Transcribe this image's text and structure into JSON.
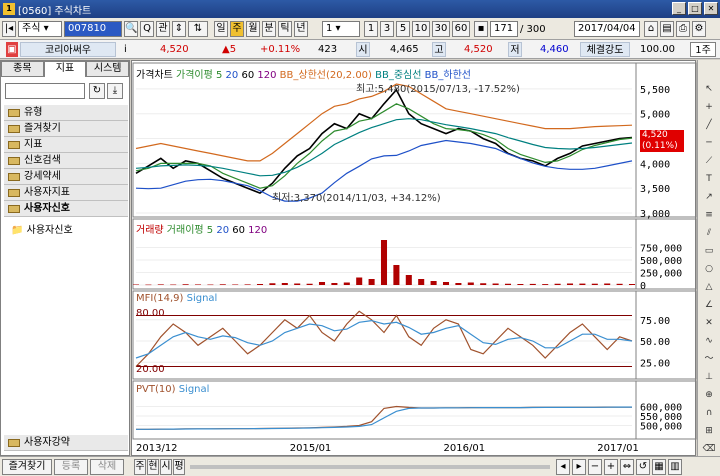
{
  "window": {
    "title": "[0560] 주식차트"
  },
  "toolbar": {
    "market": "주식",
    "code": "007810",
    "gwan": "관",
    "periods": [
      "일",
      "주",
      "월",
      "분",
      "틱",
      "년"
    ],
    "interval": "1",
    "steps": [
      "1",
      "3",
      "5",
      "10",
      "30",
      "60"
    ],
    "count": "171",
    "total": "/ 300",
    "date": "2017/04/04"
  },
  "stock": {
    "name": "코리아써우",
    "price": "4,520",
    "change": "▲5",
    "rate": "+0.11%",
    "volume": "423",
    "open_label": "시",
    "open": "4,465",
    "high_label": "고",
    "high": "4,520",
    "low_label": "저",
    "low": "4,460",
    "strength_label": "체결강도",
    "strength": "100.00",
    "unit": "1주"
  },
  "sidebar": {
    "tabs": [
      "종목",
      "지표",
      "시스템"
    ],
    "items": [
      "유형",
      "즐겨찾기",
      "지표",
      "신호검색",
      "강세약세",
      "사용자지표",
      "사용자신호"
    ],
    "subitem": "사용자신호",
    "bottom_item": "사용자강약",
    "bottom_buttons": [
      "즐겨찾기",
      "등록",
      "삭제"
    ]
  },
  "bottom": {
    "tabs": [
      "주",
      "현",
      "시",
      "평"
    ]
  },
  "chart_data": [
    {
      "type": "line",
      "title": "가격차트",
      "legend": [
        "가격차트",
        "가격이평 5",
        "20",
        "60",
        "120",
        "BB_상한선(20,2.00)",
        "BB_중심선",
        "BB_하한선"
      ],
      "y_ticks": [
        "5,500",
        "5,000",
        "4,500",
        "4,000",
        "3,500",
        "3,000"
      ],
      "ylim": [
        3000,
        5700
      ],
      "annotations": {
        "max": "최고:5,480(2015/07/13, -17.52%)",
        "min": "최저:3,370(2014/11/03, +34.12%)"
      },
      "price_label": "4,520",
      "price_rate": "(0.11%)",
      "x": [
        0,
        1,
        2,
        3,
        4,
        5,
        6,
        7,
        8,
        9,
        10,
        11,
        12,
        13,
        14,
        15,
        16,
        17,
        18,
        19,
        20,
        21,
        22,
        23,
        24,
        25,
        26,
        27,
        28,
        29,
        30,
        31,
        32,
        33,
        34,
        35,
        36,
        37,
        38,
        39,
        40
      ],
      "series": [
        {
          "name": "가격차트",
          "color": "#000000",
          "values": [
            3800,
            3950,
            4100,
            3900,
            4050,
            4000,
            3850,
            3700,
            3600,
            3500,
            3400,
            3600,
            3900,
            4150,
            4300,
            4600,
            4800,
            4700,
            5000,
            4900,
            5200,
            5480,
            5000,
            4800,
            4700,
            4600,
            4700,
            4650,
            4500,
            4400,
            4200,
            4100,
            4050,
            3950,
            4100,
            4200,
            4350,
            4400,
            4450,
            4500,
            4520
          ]
        },
        {
          "name": "가격이평 5",
          "color": "#2e8b2e",
          "values": [
            3850,
            3900,
            4000,
            4000,
            4000,
            4000,
            3950,
            3800,
            3700,
            3600,
            3500,
            3550,
            3750,
            4000,
            4200,
            4450,
            4650,
            4700,
            4850,
            4900,
            5050,
            5200,
            5100,
            4950,
            4800,
            4700,
            4680,
            4650,
            4580,
            4480,
            4300,
            4180,
            4100,
            4020,
            4050,
            4150,
            4280,
            4360,
            4420,
            4480,
            4510
          ]
        },
        {
          "name": "BB_상한선(20,2.00)",
          "color": "#d2691e",
          "values": [
            4300,
            4350,
            4400,
            4350,
            4300,
            4250,
            4200,
            4150,
            4100,
            4050,
            4050,
            4200,
            4400,
            4600,
            4800,
            5000,
            5150,
            5200,
            5300,
            5350,
            5450,
            5600,
            5550,
            5400,
            5250,
            5100,
            5050,
            5000,
            4950,
            4900,
            4850,
            4800,
            4750,
            4700,
            4700,
            4700,
            4720,
            4740,
            4750,
            4760,
            4770
          ]
        },
        {
          "name": "BB_중심선",
          "color": "#008080",
          "values": [
            3900,
            3920,
            3950,
            3960,
            3970,
            3960,
            3940,
            3900,
            3850,
            3800,
            3750,
            3760,
            3820,
            3920,
            4050,
            4200,
            4380,
            4500,
            4620,
            4720,
            4800,
            4880,
            4900,
            4880,
            4830,
            4780,
            4740,
            4700,
            4650,
            4600,
            4520,
            4450,
            4380,
            4320,
            4300,
            4290,
            4300,
            4320,
            4350,
            4380,
            4410
          ]
        },
        {
          "name": "BB_하한선",
          "color": "#1e50c8",
          "values": [
            3500,
            3490,
            3500,
            3570,
            3640,
            3670,
            3680,
            3650,
            3600,
            3550,
            3450,
            3320,
            3240,
            3240,
            3300,
            3400,
            3610,
            3800,
            3940,
            4090,
            4150,
            4160,
            4250,
            4360,
            4410,
            4460,
            4430,
            4400,
            4350,
            4300,
            4190,
            4100,
            4010,
            3940,
            3900,
            3880,
            3880,
            3900,
            3950,
            4000,
            4050
          ]
        }
      ]
    },
    {
      "type": "bar",
      "title": "거래량",
      "legend": [
        "거래량",
        "거래이평 5",
        "20",
        "60",
        "120"
      ],
      "y_ticks": [
        "750,000",
        "500,000",
        "250,000",
        "0"
      ],
      "ylim": [
        0,
        1000000
      ],
      "x": [
        0,
        1,
        2,
        3,
        4,
        5,
        6,
        7,
        8,
        9,
        10,
        11,
        12,
        13,
        14,
        15,
        16,
        17,
        18,
        19,
        20,
        21,
        22,
        23,
        24,
        25,
        26,
        27,
        28,
        29,
        30,
        31,
        32,
        33,
        34,
        35,
        36,
        37,
        38,
        39,
        40
      ],
      "values": [
        10000,
        8000,
        12000,
        9000,
        15000,
        11000,
        9000,
        14000,
        10000,
        12000,
        20000,
        35000,
        40000,
        30000,
        25000,
        60000,
        40000,
        50000,
        150000,
        120000,
        900000,
        400000,
        200000,
        120000,
        80000,
        60000,
        40000,
        50000,
        35000,
        30000,
        25000,
        20000,
        22000,
        18000,
        25000,
        30000,
        28000,
        26000,
        30000,
        24000,
        20000
      ]
    },
    {
      "type": "line",
      "title": "MFI(14,9)",
      "legend": [
        "MFI(14,9)",
        "Signal"
      ],
      "y_ticks": [
        "75.00",
        "50.00",
        "25.00"
      ],
      "levels": [
        "80.00",
        "20.00"
      ],
      "ylim": [
        10,
        90
      ],
      "x": [
        0,
        1,
        2,
        3,
        4,
        5,
        6,
        7,
        8,
        9,
        10,
        11,
        12,
        13,
        14,
        15,
        16,
        17,
        18,
        19,
        20,
        21,
        22,
        23,
        24,
        25,
        26,
        27,
        28,
        29,
        30,
        31,
        32,
        33,
        34,
        35,
        36,
        37,
        38,
        39,
        40
      ],
      "series": [
        {
          "name": "MFI(14,9)",
          "color": "#a0522d",
          "values": [
            20,
            35,
            55,
            70,
            60,
            45,
            55,
            65,
            50,
            35,
            45,
            60,
            75,
            65,
            80,
            60,
            50,
            70,
            85,
            75,
            60,
            80,
            55,
            45,
            65,
            75,
            70,
            40,
            35,
            50,
            65,
            55,
            45,
            30,
            45,
            60,
            70,
            55,
            40,
            55,
            50
          ]
        },
        {
          "name": "Signal",
          "color": "#3b8fd0",
          "values": [
            30,
            35,
            45,
            55,
            60,
            55,
            52,
            56,
            54,
            48,
            45,
            50,
            60,
            65,
            70,
            68,
            62,
            64,
            72,
            74,
            70,
            72,
            66,
            58,
            60,
            65,
            68,
            58,
            48,
            46,
            52,
            54,
            50,
            42,
            42,
            50,
            58,
            58,
            52,
            52,
            50
          ]
        }
      ]
    },
    {
      "type": "line",
      "title": "PVT(10)",
      "legend": [
        "PVT(10)",
        "Signal"
      ],
      "y_ticks": [
        "600,000",
        "550,000",
        "500,000"
      ],
      "ylim": [
        450000,
        650000
      ],
      "x_ticks": [
        "2013/12",
        "2015/01",
        "2016/01",
        "2017/01"
      ],
      "x": [
        0,
        1,
        2,
        3,
        4,
        5,
        6,
        7,
        8,
        9,
        10,
        11,
        12,
        13,
        14,
        15,
        16,
        17,
        18,
        19,
        20,
        21,
        22,
        23,
        24,
        25,
        26,
        27,
        28,
        29,
        30,
        31,
        32,
        33,
        34,
        35,
        36,
        37,
        38,
        39,
        40
      ],
      "series": [
        {
          "name": "PVT(10)",
          "color": "#a0522d",
          "values": [
            480000,
            480000,
            481000,
            481000,
            482000,
            482000,
            482000,
            483000,
            483000,
            483000,
            484000,
            485000,
            486000,
            487000,
            488000,
            490000,
            492000,
            495000,
            500000,
            520000,
            590000,
            600000,
            595000,
            592000,
            592000,
            593000,
            593000,
            594000,
            594000,
            594000,
            594000,
            594000,
            595000,
            595000,
            595000,
            596000,
            596000,
            596000,
            597000,
            597000,
            597000
          ]
        },
        {
          "name": "Signal",
          "color": "#3b8fd0",
          "values": [
            480000,
            480000,
            480500,
            481000,
            481500,
            482000,
            482000,
            482500,
            483000,
            483000,
            483500,
            484000,
            485000,
            486000,
            487000,
            488500,
            490000,
            492000,
            495000,
            505000,
            540000,
            575000,
            590000,
            592000,
            592000,
            592500,
            593000,
            593500,
            594000,
            594000,
            594000,
            594000,
            594500,
            595000,
            595000,
            595500,
            596000,
            596000,
            596500,
            597000,
            597000
          ]
        }
      ]
    }
  ]
}
